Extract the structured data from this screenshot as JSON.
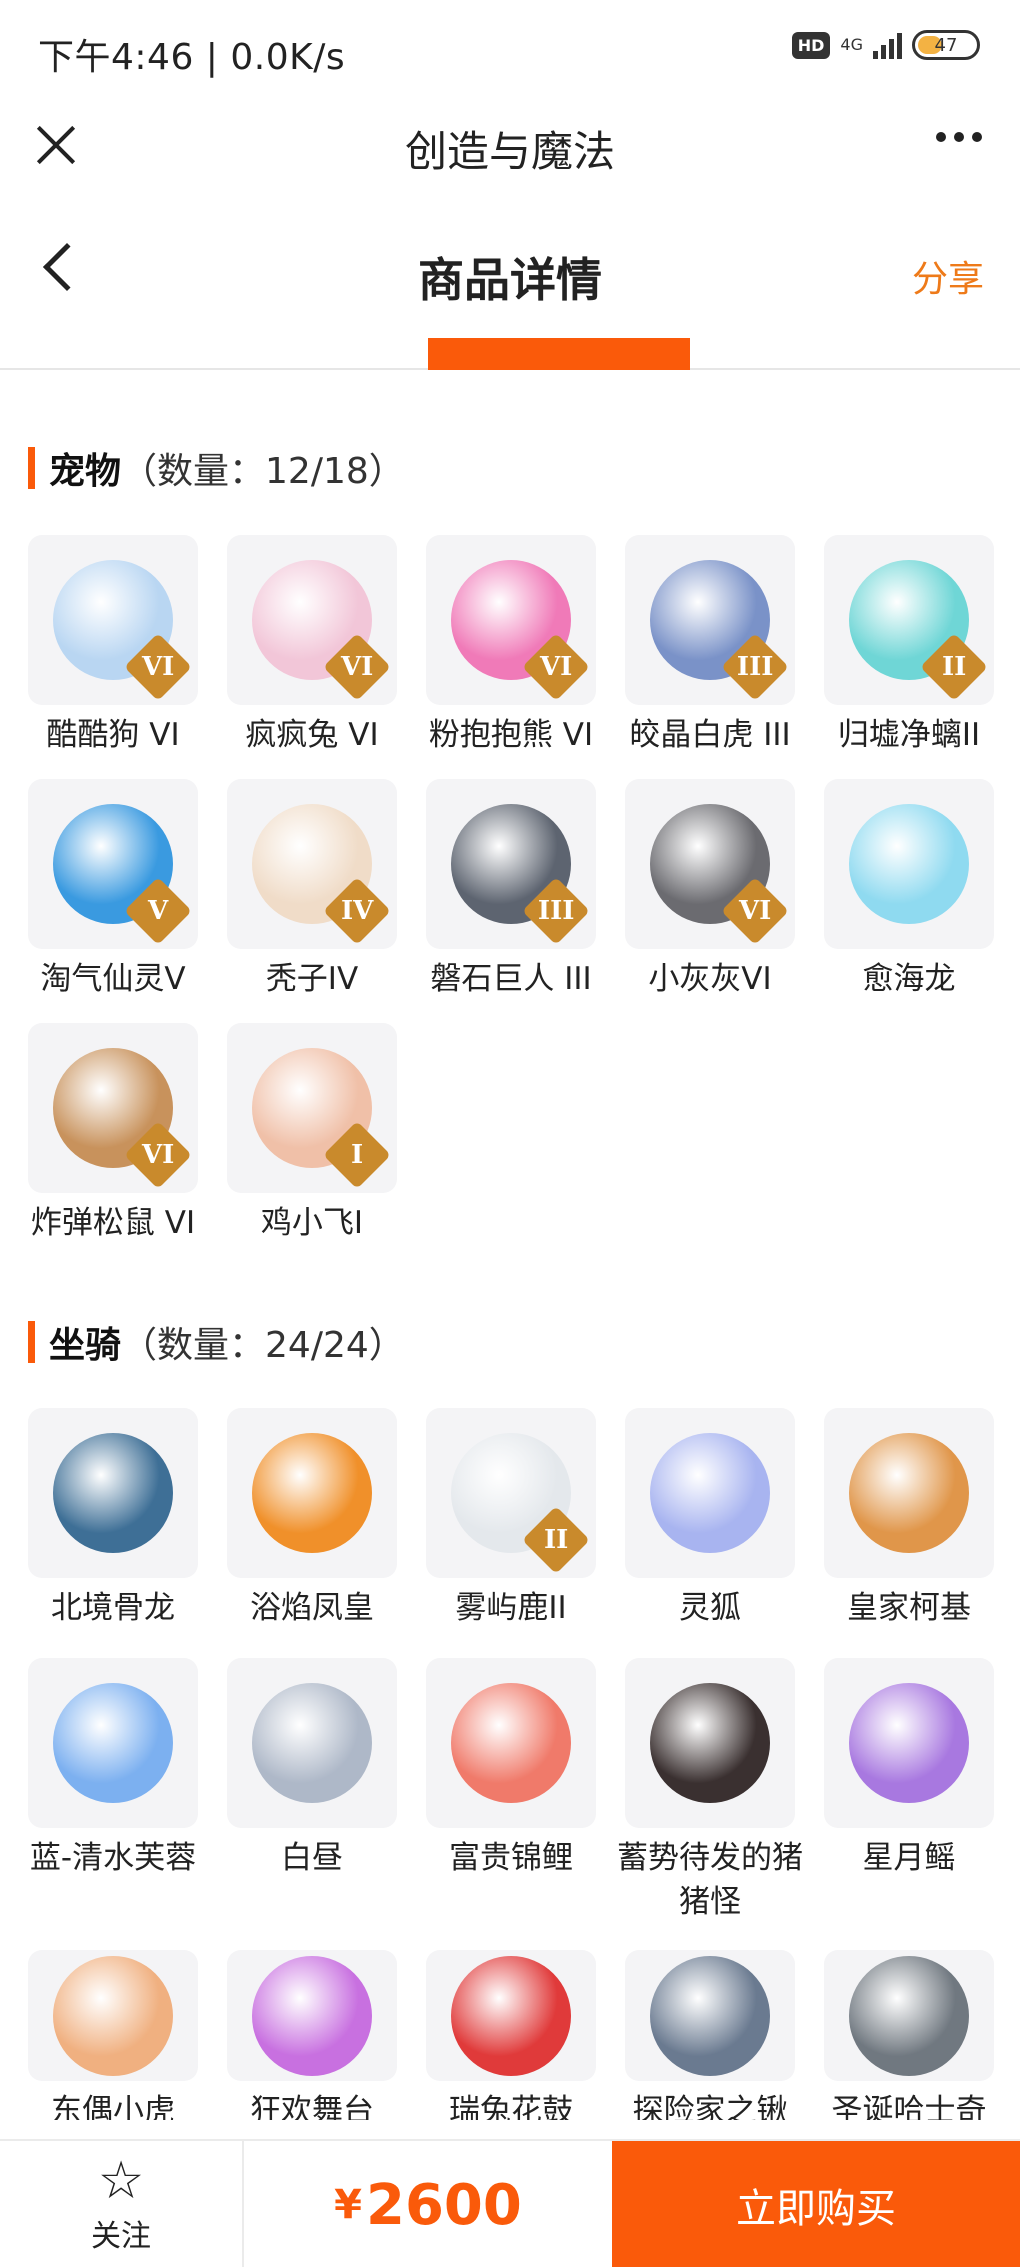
{
  "status_bar": {
    "time": "下午4:46 | 0.0K/s",
    "hd": "HD",
    "network": "4G",
    "battery": "47"
  },
  "app": {
    "title": "创造与魔法"
  },
  "header": {
    "title": "商品详情",
    "share": "分享"
  },
  "pets": {
    "name": "宠物",
    "count": "（数量：12/18）",
    "items": [
      {
        "label": "酷酷狗 VI",
        "tier": "VI",
        "color": "#b9d6f2"
      },
      {
        "label": "疯疯兔 VI",
        "tier": "VI",
        "color": "#f2c6d8"
      },
      {
        "label": "粉抱抱熊 VI",
        "tier": "VI",
        "color": "#f07ab8"
      },
      {
        "label": "皎晶白虎 III",
        "tier": "III",
        "color": "#7a92c8"
      },
      {
        "label": "归墟净螭II",
        "tier": "II",
        "color": "#6fd6d6"
      },
      {
        "label": "淘气仙灵V",
        "tier": "V",
        "color": "#3a9ae0"
      },
      {
        "label": "秃子IV",
        "tier": "IV",
        "color": "#f0dcc8"
      },
      {
        "label": "磐石巨人 III",
        "tier": "III",
        "color": "#5d6470"
      },
      {
        "label": "小灰灰VI",
        "tier": "VI",
        "color": "#6b6b70"
      },
      {
        "label": "愈海龙",
        "tier": "",
        "color": "#8fdaf0"
      },
      {
        "label": "炸弹松鼠 VI",
        "tier": "VI",
        "color": "#c8925c"
      },
      {
        "label": "鸡小飞I",
        "tier": "I",
        "color": "#f0c0a8"
      }
    ]
  },
  "mounts": {
    "name": "坐骑",
    "count": "（数量：24/24）",
    "items": [
      {
        "label": "北境骨龙",
        "tier": "",
        "color": "#3e6f96"
      },
      {
        "label": "浴焰凤皇",
        "tier": "",
        "color": "#f0902a"
      },
      {
        "label": "雾屿鹿II",
        "tier": "II",
        "color": "#e4e8ec"
      },
      {
        "label": "灵狐",
        "tier": "",
        "color": "#a8b4f0"
      },
      {
        "label": "皇家柯基",
        "tier": "",
        "color": "#e0964a"
      },
      {
        "label": "蓝-清水芙蓉",
        "tier": "",
        "color": "#7cb0f0"
      },
      {
        "label": "白昼",
        "tier": "",
        "color": "#aeb8c8"
      },
      {
        "label": "富贵锦鲤",
        "tier": "",
        "color": "#f07a6a"
      },
      {
        "label": "蓄势待发的猪猪怪",
        "tier": "",
        "color": "#3a3030"
      },
      {
        "label": "星月鳐",
        "tier": "",
        "color": "#a878e0"
      },
      {
        "label": "东偶小虎",
        "tier": "",
        "color": "#f0b080"
      },
      {
        "label": "狂欢舞台",
        "tier": "",
        "color": "#c870e0"
      },
      {
        "label": "瑞兔花鼓",
        "tier": "",
        "color": "#e03a3a"
      },
      {
        "label": "探险家之锹",
        "tier": "",
        "color": "#6a7a90"
      },
      {
        "label": "圣诞哈士奇",
        "tier": "",
        "color": "#707880"
      }
    ]
  },
  "bottom_bar": {
    "follow": "关注",
    "currency": "¥",
    "price": "2600",
    "buy": "立即购买"
  },
  "colors": {
    "accent": "#fa5a0a",
    "share": "#ee7a19",
    "badge": "#c98a2c"
  }
}
